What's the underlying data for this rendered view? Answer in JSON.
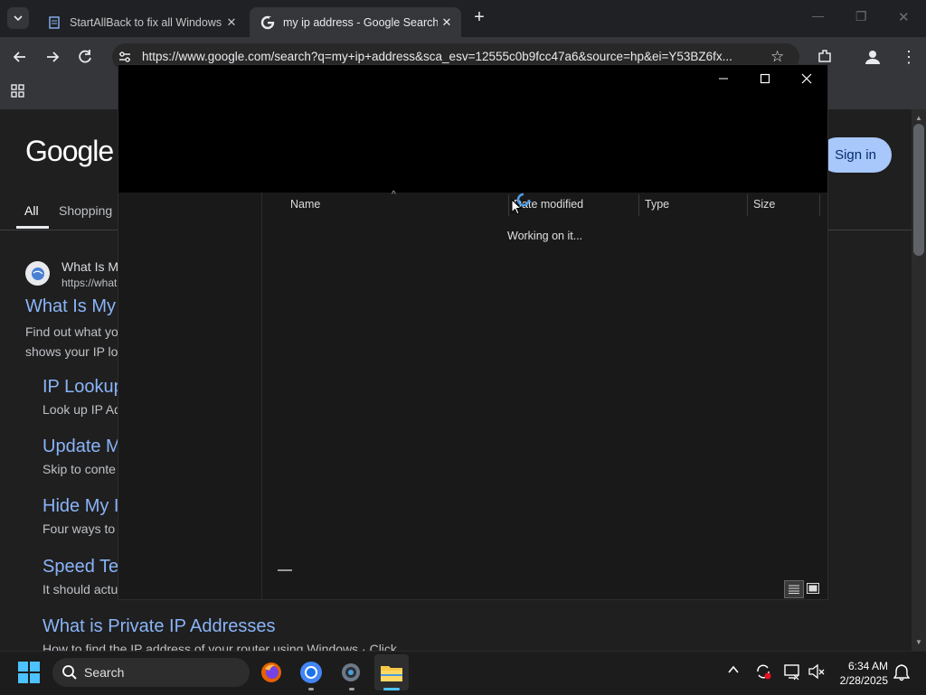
{
  "browser": {
    "tabs": [
      {
        "title": "StartAllBack to fix all Windows",
        "close": "✕"
      },
      {
        "title": "my ip address - Google Search",
        "close": "✕"
      }
    ],
    "new_tab": "+",
    "url": "https://www.google.com/search?q=my+ip+address&sca_esv=12555c0b9fcc47a6&source=hp&ei=Y53BZ6fx...",
    "window_controls": {
      "minimize": "—",
      "restore": "❐",
      "close": "✕"
    }
  },
  "google": {
    "logo": "Google",
    "sign_in": "Sign in",
    "tabs": {
      "all": "All",
      "shopping": "Shopping"
    },
    "result": {
      "site": "What Is M",
      "site_url": "https://what",
      "title": "What Is My",
      "snippet1": "Find out what yo",
      "snippet2": "shows your IP lo"
    },
    "sublinks": [
      {
        "title": "IP Lookup",
        "desc": "Look up IP Ad"
      },
      {
        "title": "Update M",
        "desc": "Skip to conte"
      },
      {
        "title": "Hide My I",
        "desc": "Four ways to"
      },
      {
        "title": "Speed Te",
        "desc": "It should actu"
      },
      {
        "title": "What is Private IP Addresses",
        "desc": "How to find the IP address of your router using Windows · Click"
      }
    ]
  },
  "explorer": {
    "columns": {
      "name": "Name",
      "date": "Date modified",
      "type": "Type",
      "size": "Size"
    },
    "status": "Working on it..."
  },
  "taskbar": {
    "search_label": "Search",
    "time": "6:34 AM",
    "date": "2/28/2025"
  }
}
